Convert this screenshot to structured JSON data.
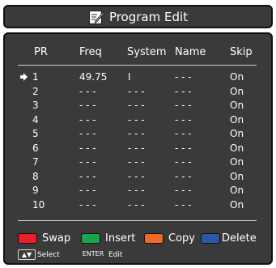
{
  "title": {
    "text": "Program Edit",
    "icon": "edit-icon"
  },
  "columns": [
    "PR",
    "Freq",
    "System",
    "Name",
    "Skip"
  ],
  "rows": [
    {
      "pr": "1",
      "freq": "49.75",
      "system": "I",
      "name": "- - -",
      "skip": "On",
      "selected": true
    },
    {
      "pr": "2",
      "freq": "- - -",
      "system": "- - -",
      "name": "- - -",
      "skip": "On",
      "selected": false
    },
    {
      "pr": "3",
      "freq": "- - -",
      "system": "- - -",
      "name": "- - -",
      "skip": "On",
      "selected": false
    },
    {
      "pr": "4",
      "freq": "- - -",
      "system": "- - -",
      "name": "- - -",
      "skip": "On",
      "selected": false
    },
    {
      "pr": "5",
      "freq": "- - -",
      "system": "- - -",
      "name": "- - -",
      "skip": "On",
      "selected": false
    },
    {
      "pr": "6",
      "freq": "- - -",
      "system": "- - -",
      "name": "- - -",
      "skip": "On",
      "selected": false
    },
    {
      "pr": "7",
      "freq": "- - -",
      "system": "- - -",
      "name": "- - -",
      "skip": "On",
      "selected": false
    },
    {
      "pr": "8",
      "freq": "- - -",
      "system": "- - -",
      "name": "- - -",
      "skip": "On",
      "selected": false
    },
    {
      "pr": "9",
      "freq": "- - -",
      "system": "- - -",
      "name": "- - -",
      "skip": "On",
      "selected": false
    },
    {
      "pr": "10",
      "freq": "- - -",
      "system": "- - -",
      "name": "- - -",
      "skip": "On",
      "selected": false
    }
  ],
  "legend": [
    {
      "label": "Swap",
      "color": "#e8202a"
    },
    {
      "label": "Insert",
      "color": "#17a64a"
    },
    {
      "label": "Copy",
      "color": "#ee6b25"
    },
    {
      "label": "Delete",
      "color": "#2d58a6"
    }
  ],
  "hints": {
    "select_key": "▲▼",
    "select_label": "Select",
    "edit_key": "ENTER",
    "edit_label": "Edit"
  }
}
